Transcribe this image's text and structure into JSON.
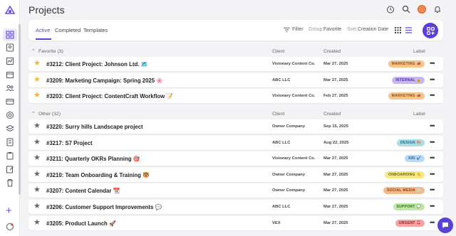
{
  "page": {
    "title": "Projects"
  },
  "toolbar": {
    "tabs": [
      {
        "label": "Active"
      },
      {
        "label": "Completed"
      },
      {
        "label": "Templates"
      }
    ],
    "filter_label": "Filter",
    "group_prefix": "Group:",
    "group_value": "Favorite",
    "sort_prefix": "Sort:",
    "sort_value": "Creation Date"
  },
  "columns": {
    "client": "Client",
    "created": "Created",
    "label": "Label"
  },
  "sections": [
    {
      "heading": "Favorite (3)",
      "rows": [
        {
          "title": "#3212: Client Project: Johnson Ltd. 🗺️",
          "client": "Visionary Content Co.",
          "created": "Mar 27, 2025",
          "label": "MARKETING 📣",
          "label_bg": "#f7c58a",
          "label_fg": "#8a4a12",
          "starred": true
        },
        {
          "title": "#3209: Marketing Campaign: Spring 2025 🌸",
          "client": "ABC LLC",
          "created": "Mar 27, 2025",
          "label": "INTERNAL 🔒",
          "label_bg": "#c9b6f2",
          "label_fg": "#4a2f9a",
          "starred": true
        },
        {
          "title": "#3203: Client Project: ContentCraft Workflow 📝",
          "client": "Visionary Content Co.",
          "created": "Feb 27, 2025",
          "label": "MARKETING 📣",
          "label_bg": "#f7c58a",
          "label_fg": "#8a4a12",
          "starred": true
        }
      ]
    },
    {
      "heading": "Other (32)",
      "rows": [
        {
          "title": "#3220: Surry hills Landscape project",
          "client": "Owner Company",
          "created": "Sep 15, 2025",
          "label": "",
          "label_bg": "",
          "label_fg": "",
          "starred": false
        },
        {
          "title": "#3217: S7 Project",
          "client": "ABC LLC",
          "created": "Aug 22, 2025",
          "label": "DESIGN 🎨",
          "label_bg": "#a9dde8",
          "label_fg": "#1d6a7a",
          "starred": false
        },
        {
          "title": "#3211: Quarterly OKRs Planning 🎯",
          "client": "Visionary Content Co.",
          "created": "Mar 27, 2025",
          "label": "KRI ✔️",
          "label_bg": "#b7d9f5",
          "label_fg": "#1f5c8c",
          "starred": false
        },
        {
          "title": "#3210: Team Onboarding & Training 🐯",
          "client": "Owner Company",
          "created": "Mar 27, 2025",
          "label": "ONBOARDING 👏",
          "label_bg": "#f7e98a",
          "label_fg": "#6e5d0a",
          "starred": false
        },
        {
          "title": "#3207: Content Calendar 📆",
          "client": "Owner Company",
          "created": "Mar 27, 2025",
          "label": "SOCIAL MEDIA 💿",
          "label_bg": "#f6b98a",
          "label_fg": "#8a3d10",
          "starred": false
        },
        {
          "title": "#3206: Customer Support Improvements 💬",
          "client": "ABC LLC",
          "created": "Mar 27, 2025",
          "label": "SUPPORT 💬",
          "label_bg": "#bfe8a8",
          "label_fg": "#356b1c",
          "starred": false
        },
        {
          "title": "#3205: Product Launch 🚀",
          "client": "VEX",
          "created": "Mar 27, 2025",
          "label": "URGENT 🚨",
          "label_bg": "#f5a3a3",
          "label_fg": "#8c1e1e",
          "starred": false
        }
      ]
    }
  ],
  "colors": {
    "accent": "#5b3fd6",
    "star_fav": "#f5b82e",
    "star_off": "#666666"
  }
}
